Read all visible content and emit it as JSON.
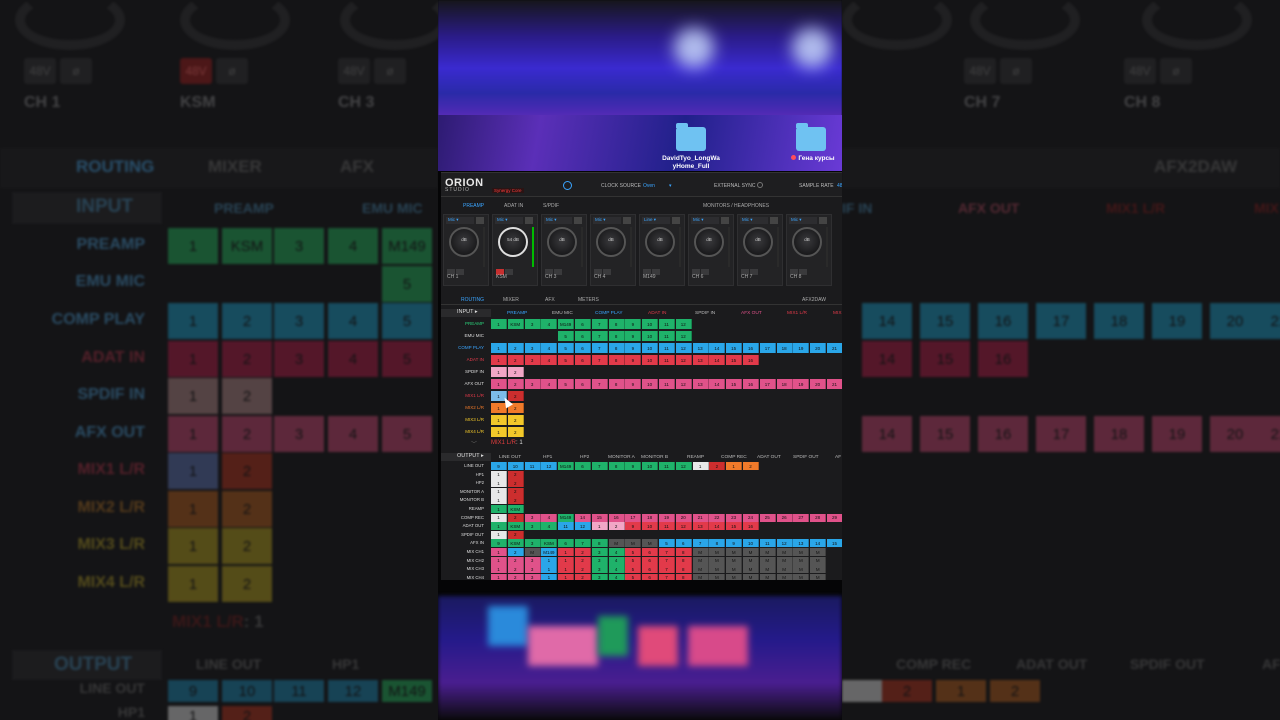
{
  "background": {
    "channel_names": [
      "CH 1",
      "KSM",
      "CH 3",
      "CH 7",
      "CH 8"
    ],
    "buttons": [
      "48V",
      "ø",
      "48V",
      "ø",
      "48V",
      "ø",
      "48V",
      "ø",
      "48V",
      "ø"
    ],
    "tabs": [
      "ROUTING",
      "MIXER",
      "AFX",
      "AFX2DAW"
    ],
    "left_rows": [
      "INPUT",
      "PREAMP",
      "EMU MIC",
      "COMP PLAY",
      "ADAT IN",
      "SPDIF IN",
      "AFX OUT",
      "MIX1 L/R",
      "MIX2 L/R",
      "MIX3 L/R",
      "MIX4 L/R"
    ],
    "left_headers": [
      "PREAMP",
      "EMU MIC"
    ],
    "mix_label": "MIX1 L/R",
    "mix_value": ": 1",
    "output_label": "OUTPUT",
    "output_headers": [
      "LINE OUT",
      "HP1"
    ],
    "output_rows": [
      "LINE OUT",
      "HP1"
    ],
    "right_headers": [
      "IF IN",
      "AFX OUT",
      "MIX1 L/R",
      "MIX"
    ],
    "right_numbers": [
      "14",
      "15",
      "16",
      "17",
      "18",
      "19",
      "20",
      "21"
    ],
    "right_out_headers": [
      "COMP REC",
      "ADAT OUT",
      "SPDIF OUT",
      "AF"
    ]
  },
  "desktop": {
    "folders": [
      {
        "label": "DavidTyo_LongWa yHome_Full"
      },
      {
        "label": "Гена курсы"
      }
    ]
  },
  "app": {
    "logo": "ORION",
    "logo_sub": "STUDIO",
    "badge": "Synergy Core",
    "clock_source_label": "CLOCK SOURCE",
    "clock_source_value": "Oven",
    "external_sync_label": "EXTERNAL SYNC",
    "sample_rate_label": "SAMPLE RATE",
    "sample_rate_value": "48",
    "top_tabs": [
      "PREAMP",
      "ADAT IN",
      "S/PDIF",
      "MONITORS / HEADPHONES"
    ],
    "channels": [
      {
        "input": "Mic",
        "value": "dB",
        "name": "CH 1"
      },
      {
        "input": "Mic",
        "value": "54 dB",
        "name": "KSM"
      },
      {
        "input": "Mic",
        "value": "dB",
        "name": "CH 3"
      },
      {
        "input": "Mic",
        "value": "dB",
        "name": "CH 4"
      },
      {
        "input": "Line",
        "value": "dB",
        "name": "M149"
      },
      {
        "input": "Mic",
        "value": "dB",
        "name": "CH 6"
      },
      {
        "input": "Mic",
        "value": "dB",
        "name": "CH 7"
      },
      {
        "input": "Mic",
        "value": "dB",
        "name": "CH 8"
      }
    ],
    "sub_tabs": [
      "ROUTING",
      "MIXER",
      "AFX",
      "METERS",
      "AFX2DAW"
    ],
    "input_section": "INPUT",
    "input_headers": [
      "PREAMP",
      "EMU MIC",
      "COMP PLAY",
      "ADAT IN",
      "SPDIF IN",
      "AFX OUT",
      "MIX1 L/R",
      "MIX"
    ],
    "input_rows": [
      "PREAMP",
      "EMU MIC",
      "COMP PLAY",
      "ADAT IN",
      "SPDIF IN",
      "AFX OUT",
      "MIX1 L/R",
      "MIX2 L/R",
      "MIX3 L/R",
      "MIX4 L/R"
    ],
    "mix_selected": "MIX1 L/R",
    "mix_selected_value": ": 1",
    "output_section": "OUTPUT",
    "output_headers": [
      "LINE OUT",
      "HP1",
      "HP2",
      "MONITOR A",
      "MONITOR B",
      "REAMP",
      "COMP REC",
      "ADAT OUT",
      "SPDIF OUT",
      "AF"
    ],
    "output_rows": [
      "LINE OUT",
      "HP1",
      "HP2",
      "MONITOR A",
      "MONITOR B",
      "REAMP",
      "COMP REC",
      "ADAT OUT",
      "SPDIF OUT",
      "AFX IN",
      "MIX CH1",
      "MIX CH2",
      "MIX CH3",
      "MIX CH4"
    ]
  }
}
